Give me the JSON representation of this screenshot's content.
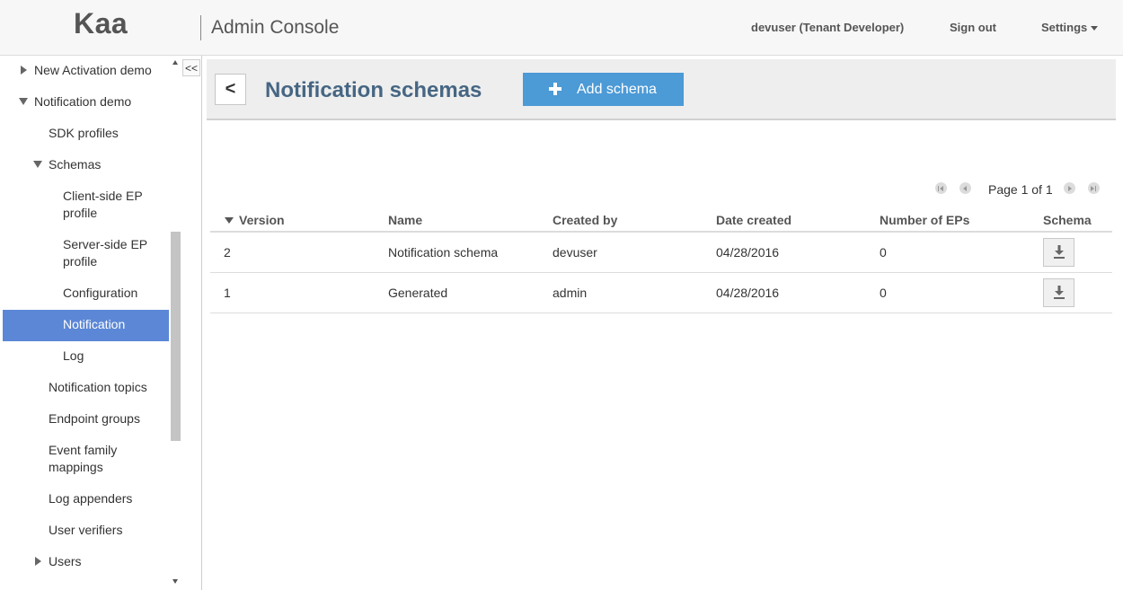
{
  "header": {
    "logo": "Kaa",
    "app_title": "Admin Console",
    "user": "devuser (Tenant Developer)",
    "sign_out": "Sign out",
    "settings": "Settings"
  },
  "sidebar": {
    "collapse_label": "<<",
    "items": [
      {
        "label": "New Activation demo",
        "expander": "collapsed"
      },
      {
        "label": "Notification demo",
        "expander": "expanded"
      },
      {
        "label": "SDK profiles"
      },
      {
        "label": "Schemas",
        "expander": "expanded"
      },
      {
        "label": "Client-side EP\nprofile"
      },
      {
        "label": "Server-side EP\nprofile"
      },
      {
        "label": "Configuration"
      },
      {
        "label": "Notification",
        "selected": true
      },
      {
        "label": "Log"
      },
      {
        "label": "Notification topics"
      },
      {
        "label": "Endpoint groups"
      },
      {
        "label": "Event family\nmappings"
      },
      {
        "label": "Log appenders"
      },
      {
        "label": "User verifiers"
      },
      {
        "label": "Users",
        "expander": "collapsed"
      }
    ]
  },
  "toolbar": {
    "back_label": "<",
    "title": "Notification schemas",
    "add_label": "Add schema"
  },
  "pager": {
    "text": "Page 1 of 1"
  },
  "table": {
    "columns": [
      "Version",
      "Name",
      "Created by",
      "Date created",
      "Number of EPs",
      "Schema"
    ],
    "rows": [
      {
        "version": "2",
        "name": "Notification schema",
        "created_by": "devuser",
        "date": "04/28/2016",
        "eps": "0"
      },
      {
        "version": "1",
        "name": "Generated",
        "created_by": "admin",
        "date": "04/28/2016",
        "eps": "0"
      }
    ]
  },
  "colors": {
    "accent": "#4c9ad6",
    "selected_nav": "#5b87d6",
    "title": "#466683"
  }
}
